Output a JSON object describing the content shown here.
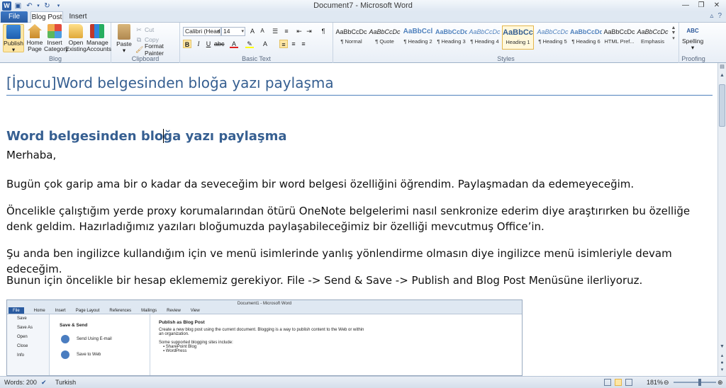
{
  "window": {
    "title": "Document7 - Microsoft Word"
  },
  "tabs": [
    {
      "label": "File"
    },
    {
      "label": "Blog Post"
    },
    {
      "label": "Insert"
    }
  ],
  "ribbon": {
    "blog": {
      "label": "Blog",
      "buttons": [
        "Publish",
        "Home Page",
        "Insert Category",
        "Open Existing",
        "Manage Accounts"
      ]
    },
    "clipboard": {
      "label": "Clipboard",
      "paste": "Paste",
      "cut": "Cut",
      "copy": "Copy",
      "format_painter": "Format Painter"
    },
    "basic_text": {
      "label": "Basic Text",
      "font_name": "Calibri (Head",
      "font_size": "14"
    },
    "styles": {
      "label": "Styles",
      "tiles": [
        {
          "sample": "AaBbCcDc",
          "name": "¶ Normal"
        },
        {
          "sample": "AaBbCcDc",
          "name": "¶ Quote"
        },
        {
          "sample": "AaBbCcl",
          "name": "¶ Heading 2"
        },
        {
          "sample": "AaBbCcDd",
          "name": "¶ Heading 3"
        },
        {
          "sample": "AaBbCcDc",
          "name": "¶ Heading 4"
        },
        {
          "sample": "AaBbCc",
          "name": "Heading 1"
        },
        {
          "sample": "AaBbCcDc",
          "name": "¶ Heading 5"
        },
        {
          "sample": "AaBbCcDd",
          "name": "¶ Heading 6"
        },
        {
          "sample": "AaBbCcDc",
          "name": "HTML Pref..."
        },
        {
          "sample": "AaBbCcDc",
          "name": "Emphasis"
        }
      ]
    },
    "proofing": {
      "label": "Proofing",
      "spelling": "Spelling",
      "abc": "ABC"
    }
  },
  "document": {
    "title": "[İpucu]Word belgesinden bloğa yazı paylaşma",
    "heading_before_caret": "Word belgesinden blo",
    "heading_after_caret": "ğa yazı paylaşma",
    "paragraphs": [
      "Merhaba,",
      "Bugün çok garip ama bir o kadar da seveceğim bir word belgesi özelliğini öğrendim. Paylaşmadan da edemeyeceğim.",
      "Öncelikle çalıştığım yerde proxy korumalarından ötürü OneNote belgelerimi nasıl senkronize ederim diye araştırırken bu özelliğe denk geldim. Hazırladığımız yazıları bloğumuzda paylaşabileceğimiz bir özelliği mevcutmuş Office’in.",
      "Şu anda ben ingilizce kullandığım için ve menü isimlerinde yanlış yönlendirme olmasın diye ingilizce menü isimleriyle devam edeceğim.",
      "Bunun için öncelikle bir hesap eklememiz gerekiyor. File -> Send & Save -> Publish and Blog Post Menüsüne ilerliyoruz."
    ],
    "embedded_screenshot": {
      "title": "Document1 - Microsoft Word",
      "tabs": [
        "File",
        "Home",
        "Insert",
        "Page Layout",
        "References",
        "Mailings",
        "Review",
        "View"
      ],
      "left_menu": [
        "Save",
        "Save As",
        "Open",
        "Close",
        "Info"
      ],
      "mid_header": "Save & Send",
      "mid_items": [
        "Send Using E-mail",
        "Save to Web"
      ],
      "right_header": "Publish as Blog Post",
      "right_text_1": "Create a new blog post using the current document. Blogging is a way to publish content to the Web or within an organization.",
      "right_text_2": "Some supported blogging sites include:",
      "right_list": [
        "SharePoint Blog",
        "WordPress"
      ]
    }
  },
  "statusbar": {
    "words": "Words: 200",
    "language": "Turkish",
    "zoom": "181%"
  }
}
